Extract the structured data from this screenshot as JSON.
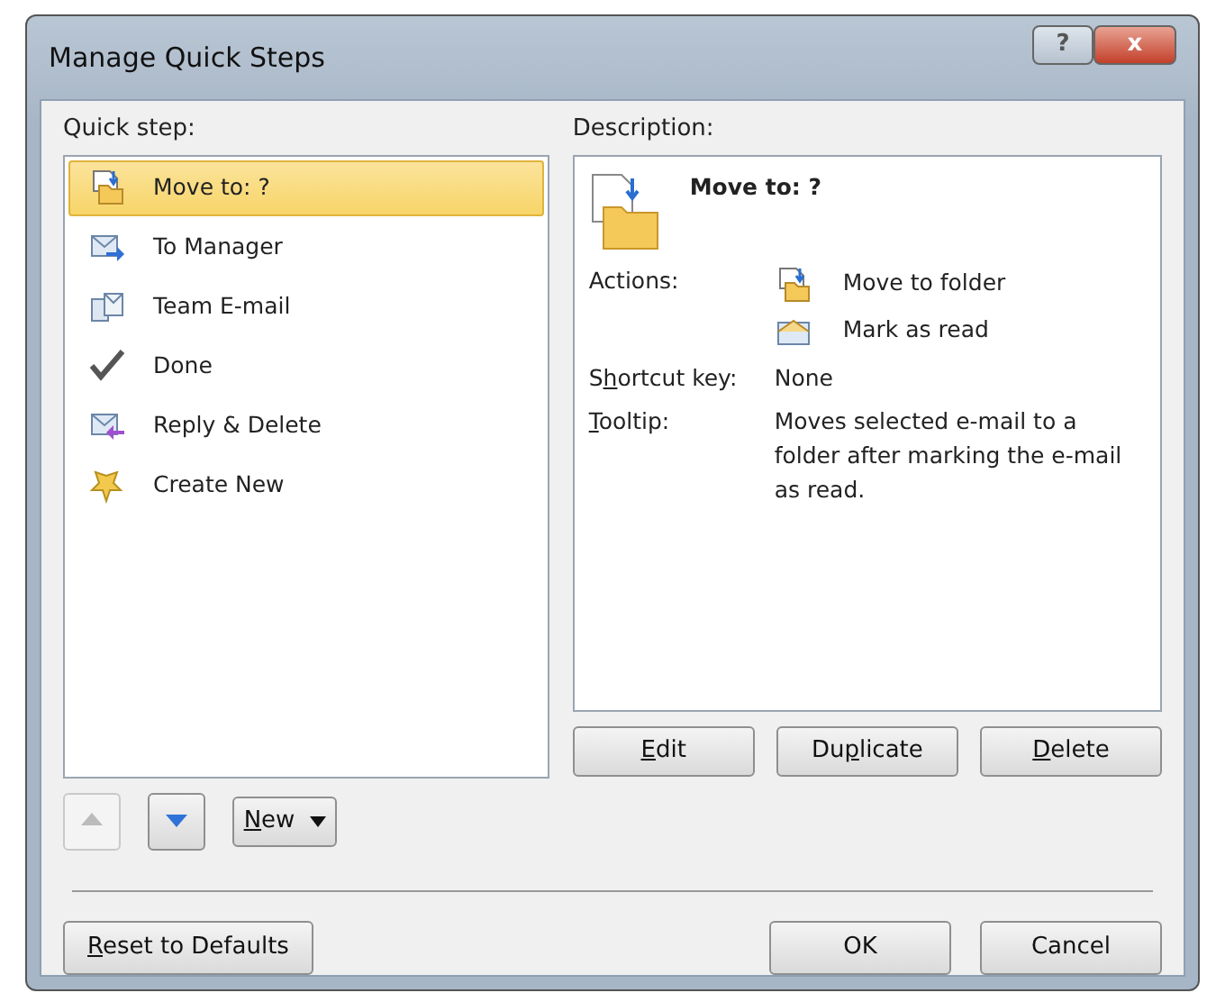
{
  "window": {
    "title": "Manage Quick Steps",
    "help_label": "?",
    "close_label": "x"
  },
  "quick_steps": {
    "label": "Quick step:",
    "items": [
      {
        "label": "Move to: ?",
        "selected": true
      },
      {
        "label": "To Manager",
        "selected": false
      },
      {
        "label": "Team E-mail",
        "selected": false
      },
      {
        "label": "Done",
        "selected": false
      },
      {
        "label": "Reply & Delete",
        "selected": false
      },
      {
        "label": "Create New",
        "selected": false
      }
    ]
  },
  "description": {
    "label": "Description:",
    "title": "Move to: ?",
    "actions_label": "Actions:",
    "actions": [
      {
        "label": "Move to folder"
      },
      {
        "label": "Mark as read"
      }
    ],
    "shortcut_label": {
      "before": "S",
      "key": "h",
      "after": "ortcut key:"
    },
    "shortcut_value": "None",
    "tooltip_label": {
      "key": "T",
      "after": "ooltip:"
    },
    "tooltip_value": "Moves selected e-mail to a folder after marking the e-mail as read."
  },
  "description_buttons": [
    {
      "key": "E",
      "after": "dit"
    },
    {
      "before": "Du",
      "key": "p",
      "after": "licate"
    },
    {
      "key": "D",
      "after": "elete"
    }
  ],
  "move_up": {
    "disabled": true
  },
  "move_down": {
    "disabled": false
  },
  "new_button": {
    "key": "N",
    "after": "ew"
  },
  "footer": {
    "reset": {
      "key": "R",
      "after": "eset to Defaults"
    },
    "ok": {
      "label": "OK"
    },
    "cancel": {
      "label": "Cancel"
    }
  }
}
